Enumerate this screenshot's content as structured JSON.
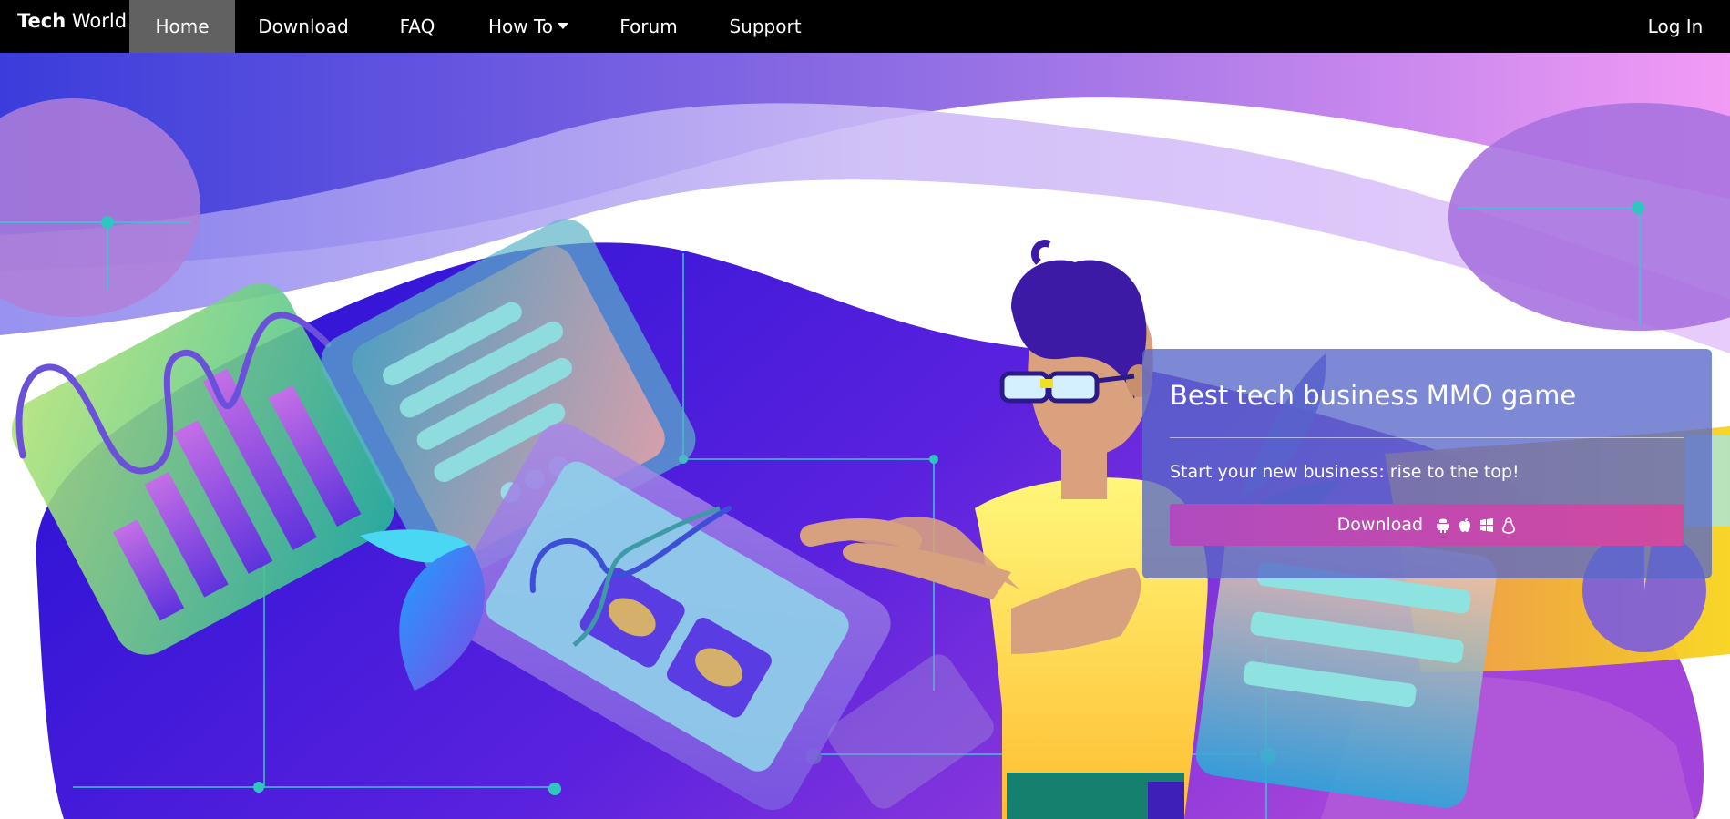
{
  "brand": {
    "bold": "Tech",
    "rest": "World"
  },
  "nav": {
    "items": [
      {
        "label": "Home",
        "active": true
      },
      {
        "label": "Download"
      },
      {
        "label": "FAQ"
      },
      {
        "label": "How To"
      },
      {
        "label": "Forum"
      },
      {
        "label": "Support"
      }
    ],
    "login": "Log In"
  },
  "hero": {
    "title": "Best tech business MMO game",
    "subtitle": "Start your new business: rise to the top!",
    "download_label": "Download",
    "download_icons": [
      "android-icon",
      "apple-icon",
      "windows-icon",
      "linux-icon"
    ]
  },
  "colors": {
    "navbar_bg": "#000000",
    "active_tab": "#616161",
    "card_bg": "#5868C8",
    "button_bg": "#C04AB0"
  }
}
